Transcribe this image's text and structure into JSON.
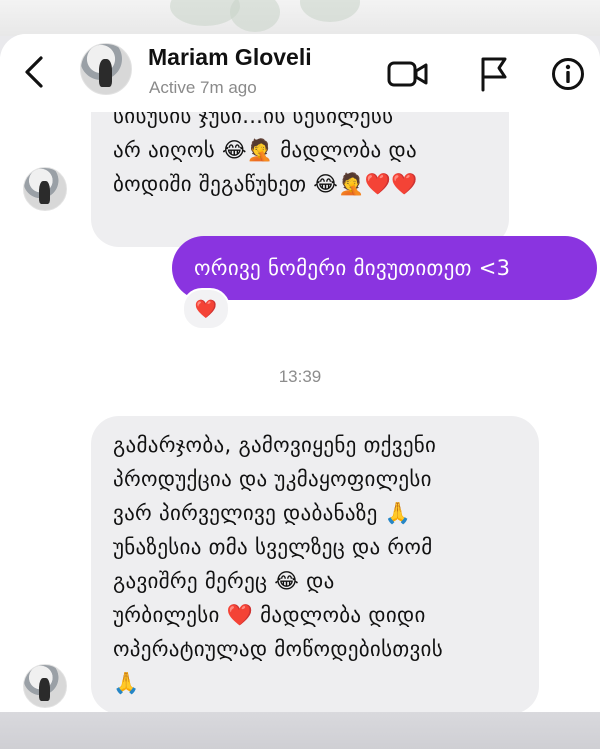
{
  "header": {
    "contact_name": "Mariam Gloveli",
    "status": "Active 7m ago"
  },
  "icons": {
    "back": "chevron-left-icon",
    "video": "video-call-icon",
    "flag": "flag-icon",
    "info": "info-icon"
  },
  "messages": {
    "received_1": {
      "lines": [
        "სისუსის ჯუსი...ის სესილესს",
        "არ აიღოს 😂🤦 მადლობა და",
        "ბოდიში შეგაწუხეთ 😂🤦❤️❤️"
      ]
    },
    "sent_1": {
      "text": "ორივე ნომერი მივუთითეთ <3",
      "reaction": "❤️"
    },
    "timestamp": "13:39",
    "received_2": {
      "lines": [
        "გამარჯობა, გამოვიყენე თქვენი",
        "პროდუქცია და უკმაყოფილესი",
        "ვარ პირველივე დაბანაზე 🙏",
        "უნაზესია თმა სველზეც და რომ",
        "გავიშრე მერეც 😂 და",
        "ურბილესი ❤️ მადლობა დიდი",
        "ოპერატიულად მოწოდებისთვის",
        "🙏"
      ]
    }
  },
  "colors": {
    "sent_bubble": "#8a34e0",
    "received_bubble": "#eeeef0",
    "heart": "#e0242e"
  }
}
